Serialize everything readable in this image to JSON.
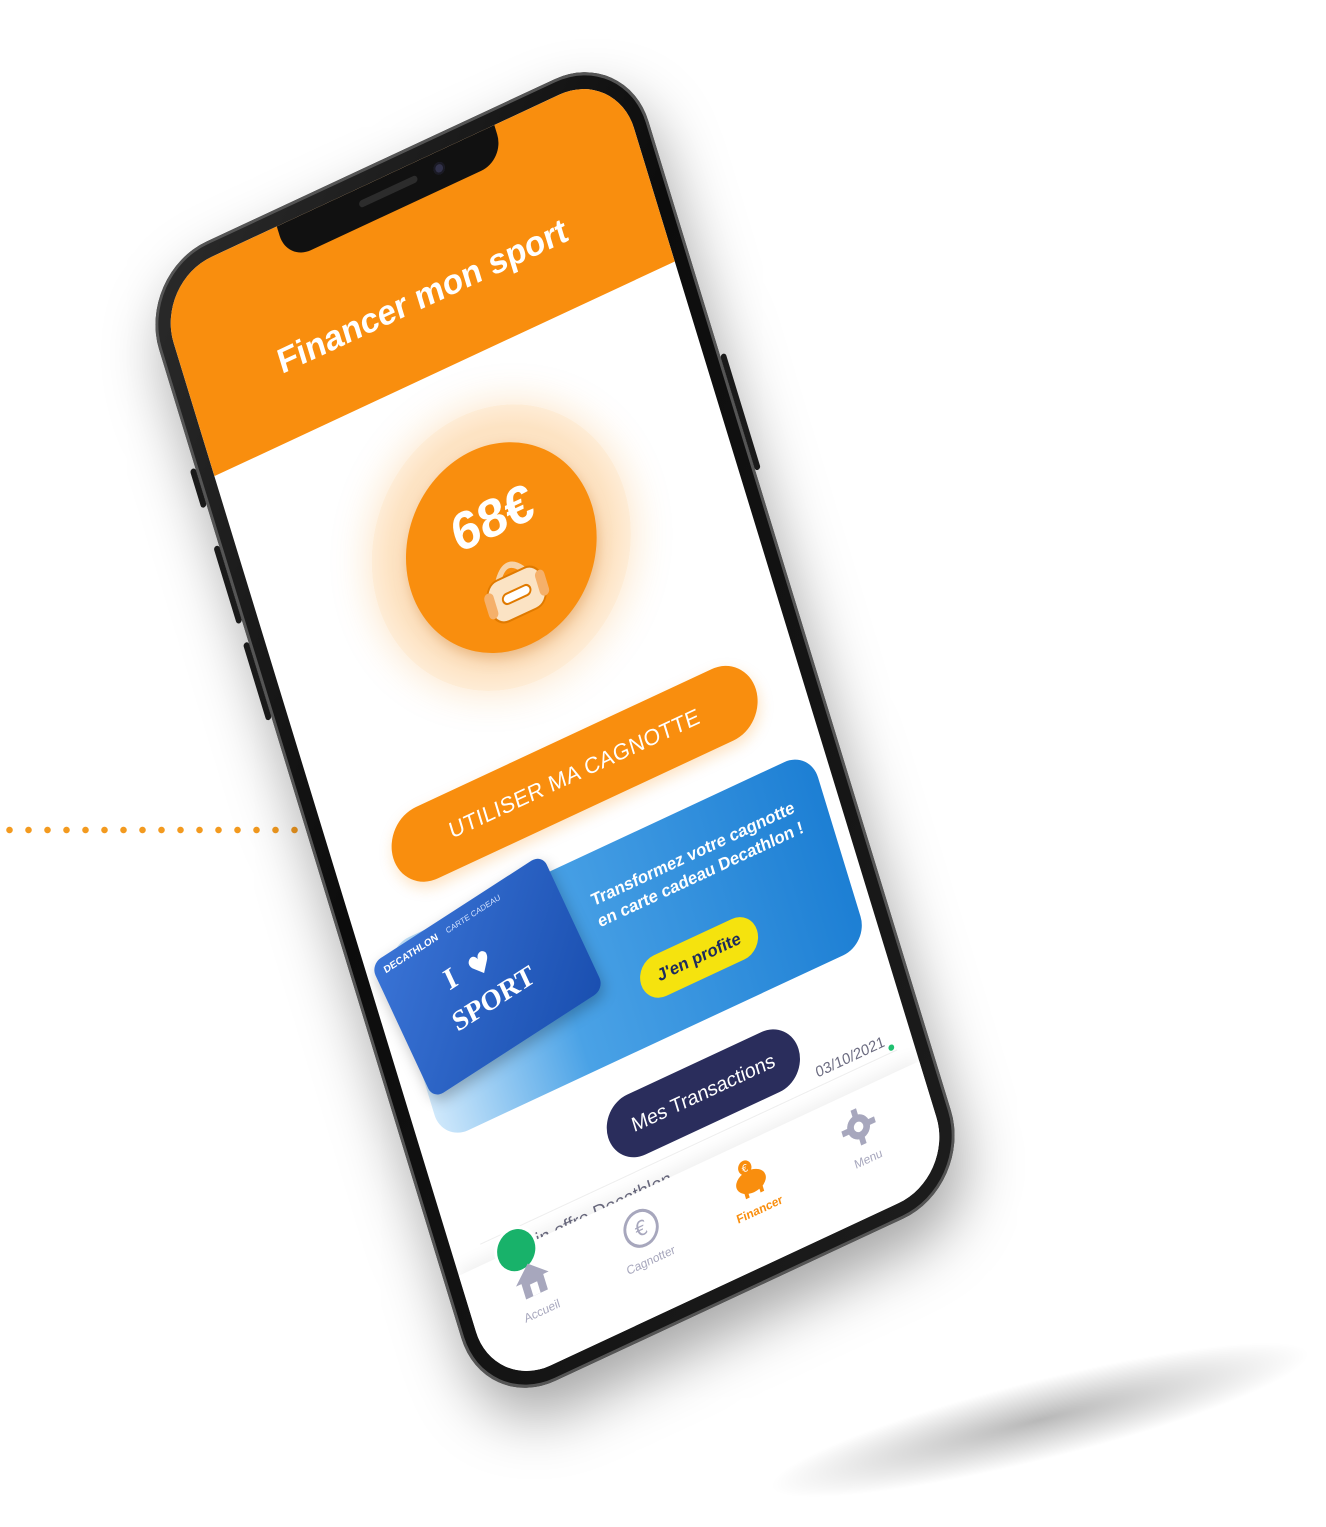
{
  "header": {
    "title": "Financer mon sport"
  },
  "balance": {
    "amount": "68€"
  },
  "actions": {
    "use_pot_label": "UTILISER MA CAGNOTTE",
    "transactions_label": "Mes Transactions"
  },
  "promo": {
    "text": "Transformez votre cagnotte en carte cadeau Decathlon !",
    "button_label": "J'en profite",
    "card_brand": "DECATHLON",
    "card_sub": "CARTE CADEAU",
    "card_line1": "I",
    "card_line2": "SPORT"
  },
  "transaction": {
    "label": "Gain offre Decathlon",
    "date": "03/10/2021"
  },
  "tabbar": {
    "items": [
      {
        "label": "Accueil",
        "icon": "home-icon"
      },
      {
        "label": "Cagnotter",
        "icon": "euro-coin-icon"
      },
      {
        "label": "Financer",
        "icon": "piggy-bank-icon",
        "active": true
      },
      {
        "label": "Menu",
        "icon": "gear-icon"
      }
    ]
  },
  "colors": {
    "primary_orange": "#f98e0e",
    "navy": "#2a2d5c",
    "promo_blue": "#1d7fd4",
    "promo_yellow": "#f5e30e",
    "tab_inactive": "#a7a7bd",
    "badge_green": "#18b26a"
  }
}
